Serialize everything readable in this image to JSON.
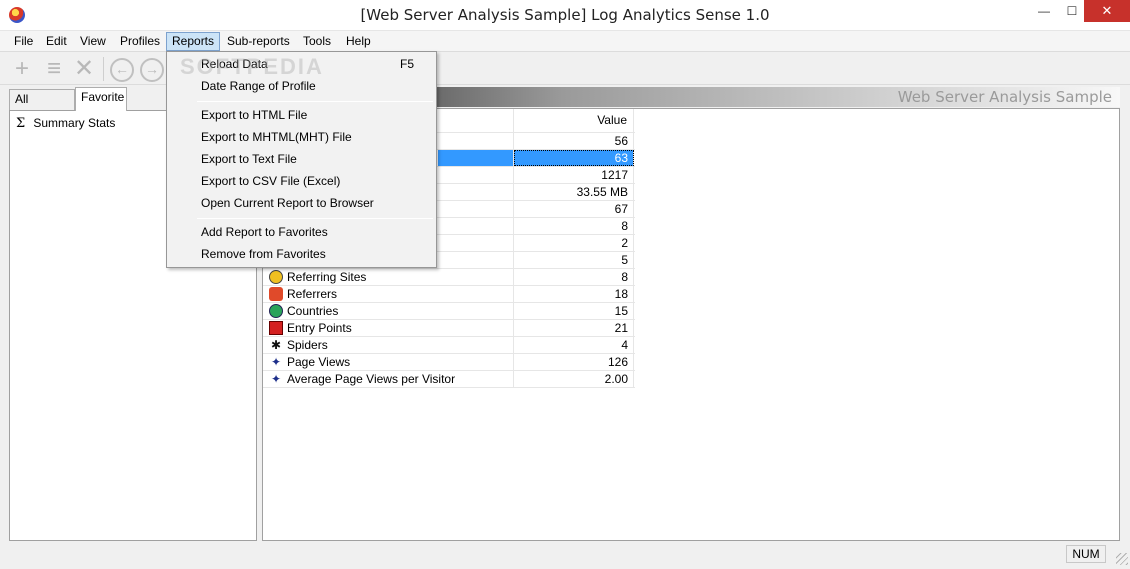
{
  "window": {
    "title": "[Web Server Analysis Sample] Log Analytics Sense 1.0",
    "min_glyph": "—",
    "max_glyph": "☐",
    "close_glyph": "✕"
  },
  "menu": {
    "file": "File",
    "edit": "Edit",
    "view": "View",
    "profiles": "Profiles",
    "reports": "Reports",
    "subreports": "Sub-reports",
    "tools": "Tools",
    "help": "Help"
  },
  "toolbar": {
    "add_icon": "+",
    "list_icon": "≡",
    "delete_icon": "✕",
    "back_icon": "←",
    "forward_icon": "→"
  },
  "left_panel": {
    "tabs": [
      "All Reports",
      "Favorite"
    ],
    "tree_item": "Summary Stats",
    "tree_icon": "Σ"
  },
  "report": {
    "header_title": "Web Server Analysis Sample",
    "col_value": "Value",
    "rows": [
      {
        "name": "",
        "value": "56",
        "icon": ""
      },
      {
        "name": "",
        "value": "63",
        "icon": ""
      },
      {
        "name": "",
        "value": "1217",
        "icon": ""
      },
      {
        "name": "",
        "value": "33.55 MB",
        "icon": ""
      },
      {
        "name": "",
        "value": "67",
        "icon": ""
      },
      {
        "name": "",
        "value": "8",
        "icon": ""
      },
      {
        "name": "",
        "value": "2",
        "icon": ""
      },
      {
        "name": "",
        "value": "5",
        "icon": ""
      },
      {
        "name": "Referring Sites",
        "value": "8",
        "icon": "sites-icon"
      },
      {
        "name": "Referrers",
        "value": "18",
        "icon": "referrers-icon"
      },
      {
        "name": "Countries",
        "value": "15",
        "icon": "globe-icon"
      },
      {
        "name": "Entry Points",
        "value": "21",
        "icon": "entry-points-icon"
      },
      {
        "name": "Spiders",
        "value": "4",
        "icon": "spider-icon"
      },
      {
        "name": "Page Views",
        "value": "126",
        "icon": "star-icon"
      },
      {
        "name": "Average Page Views per Visitor",
        "value": "2.00",
        "icon": "star-icon"
      }
    ]
  },
  "reports_menu": {
    "reload": "Reload Data",
    "reload_shortcut": "F5",
    "date_range": "Date Range of Profile",
    "export_html": "Export to HTML File",
    "export_mhtml": "Export to MHTML(MHT) File",
    "export_text": "Export to Text File",
    "export_csv": "Export to CSV File (Excel)",
    "open_browser": "Open Current Report to Browser",
    "add_fav": "Add Report to Favorites",
    "remove_fav": "Remove from Favorites"
  },
  "status": {
    "num": "NUM"
  },
  "watermark": "SOFTPEDIA",
  "colors": {
    "selection": "#3399ff",
    "close_button": "#c7312b",
    "menu_highlight": "#cce4f7"
  }
}
